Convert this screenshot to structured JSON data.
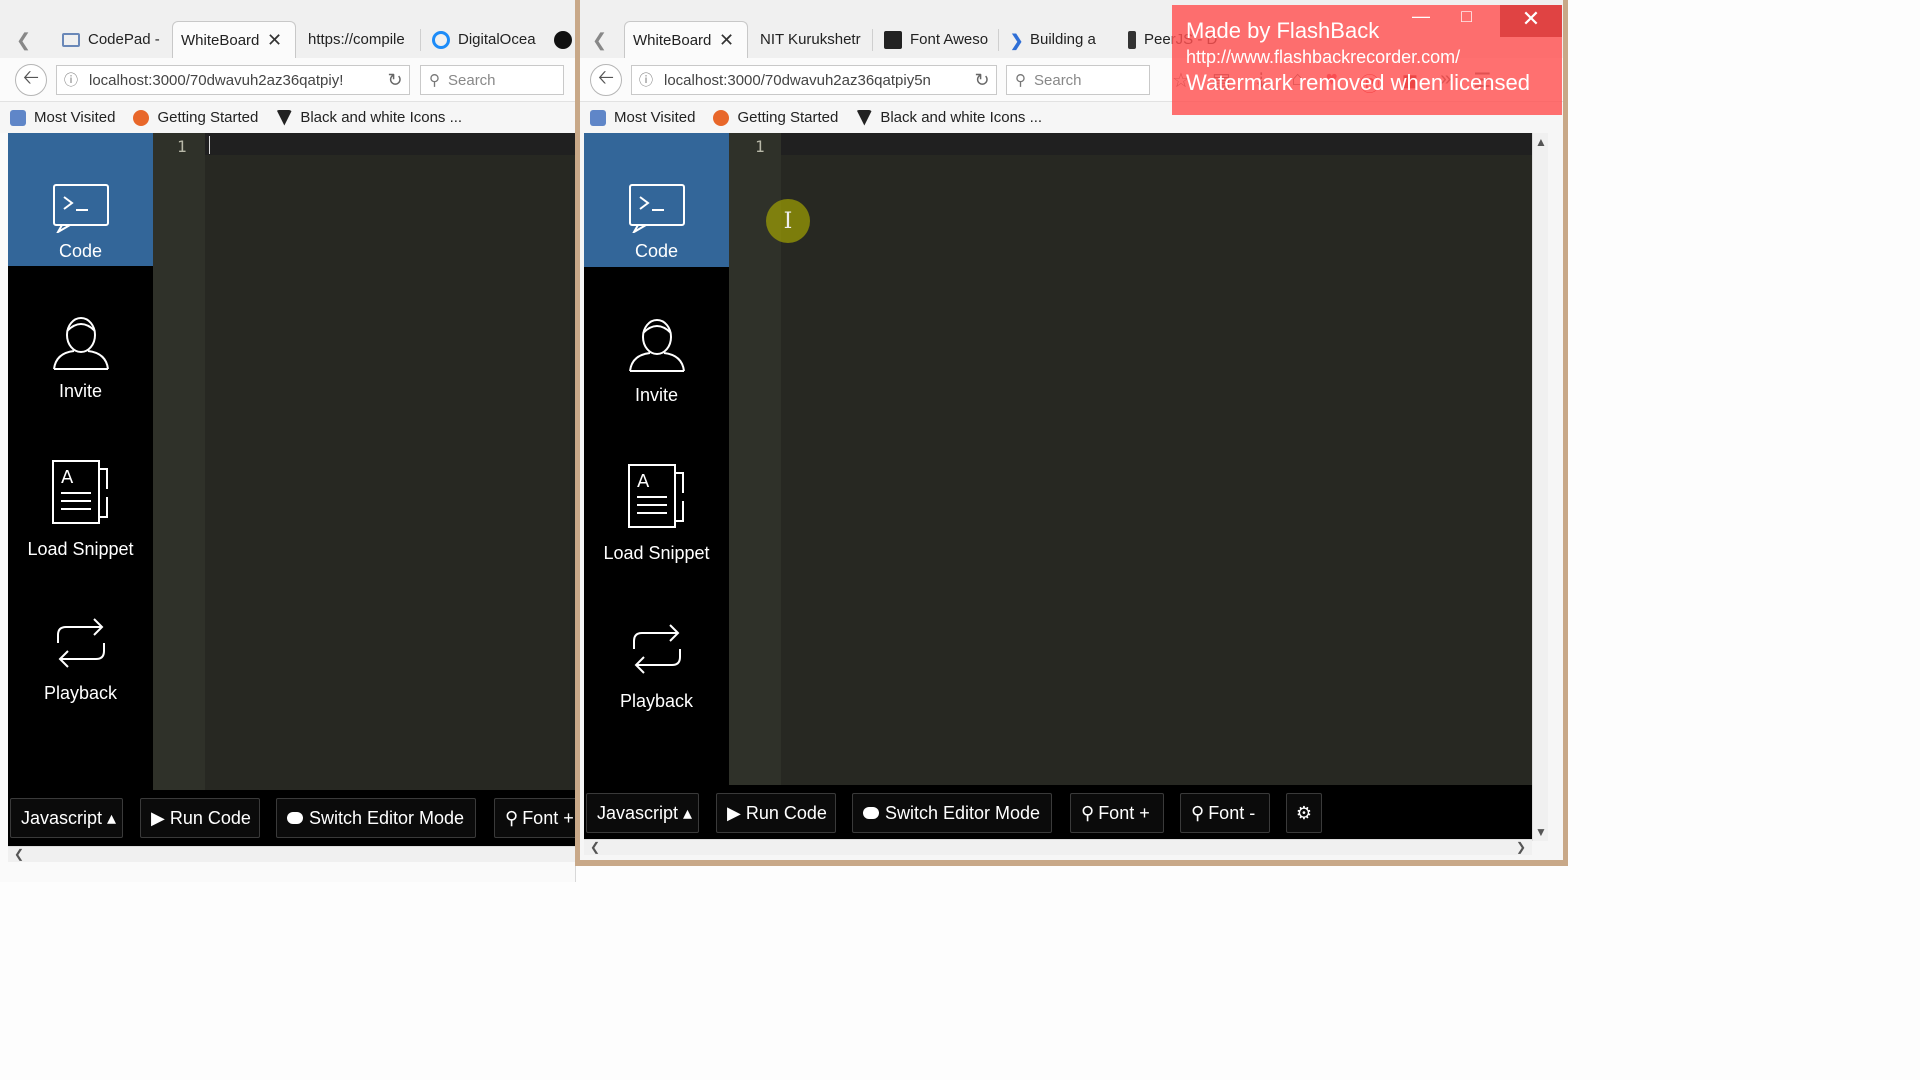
{
  "left": {
    "tabs": [
      {
        "label": "CodePad -"
      },
      {
        "label": "WhiteBoard"
      },
      {
        "label": "https://compile"
      },
      {
        "label": "DigitalOcea"
      }
    ],
    "url": "localhost:3000/70dwavuh2az36qatpiy!",
    "search_placeholder": "Search",
    "bookmarks": [
      "Most Visited",
      "Getting Started",
      "Black and white Icons ..."
    ],
    "line_number": "1",
    "sidebar": [
      {
        "label": "Code",
        "icon": "terminal-icon"
      },
      {
        "label": "Invite",
        "icon": "user-icon"
      },
      {
        "label": "Load Snippet",
        "icon": "document-icon"
      },
      {
        "label": "Playback",
        "icon": "repeat-icon"
      }
    ],
    "footer": {
      "language": "Javascript ▴",
      "run": "▶ Run Code",
      "switch": "Switch Editor Mode",
      "font_plus": "Font +"
    }
  },
  "right": {
    "tabs": [
      {
        "label": "WhiteBoard"
      },
      {
        "label": "NIT Kurukshetr"
      },
      {
        "label": "Font Aweso"
      },
      {
        "label": "Building a"
      },
      {
        "label": "PeerJS - D"
      }
    ],
    "url": "localhost:3000/70dwavuh2az36qatpiy5n",
    "search_placeholder": "Search",
    "bookmarks": [
      "Most Visited",
      "Getting Started",
      "Black and white Icons ..."
    ],
    "line_number": "1",
    "sidebar": [
      {
        "label": "Code",
        "icon": "terminal-icon"
      },
      {
        "label": "Invite",
        "icon": "user-icon"
      },
      {
        "label": "Load Snippet",
        "icon": "document-icon"
      },
      {
        "label": "Playback",
        "icon": "repeat-icon"
      }
    ],
    "footer": {
      "language": "Javascript ▴",
      "run": "▶ Run Code",
      "switch": "Switch Editor Mode",
      "font_plus": "Font +",
      "font_minus": "Font -"
    }
  },
  "watermark": {
    "line1": "Made by FlashBack",
    "line2": "http://www.flashbackrecorder.com/",
    "line3": "Watermark removed when licensed"
  },
  "colors": {
    "sidebar_active": "#336699",
    "editor_bg": "#272822",
    "sidebar_bg": "#000000"
  }
}
